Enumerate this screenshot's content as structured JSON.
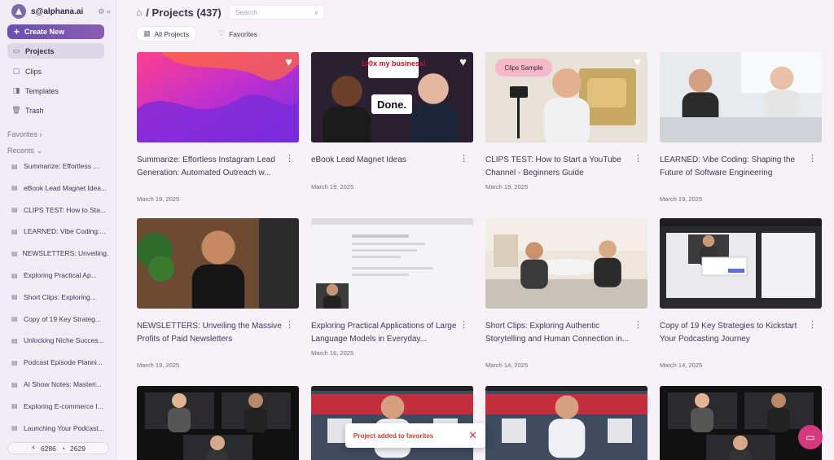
{
  "account": {
    "email": "s@alphana.ai"
  },
  "sidebar": {
    "create_label": "Create New",
    "nav": [
      {
        "label": "Projects",
        "icon": "folder-icon",
        "active": true
      },
      {
        "label": "Clips",
        "icon": "clip-icon"
      },
      {
        "label": "Templates",
        "icon": "template-icon"
      },
      {
        "label": "Trash",
        "icon": "trash-icon"
      }
    ],
    "favorites_label": "Favorites",
    "recents_label": "Recents",
    "recents": [
      "Summarize: Effortless ...",
      "eBook Lead Magnet Idea...",
      "CLIPS TEST: How to Sta...",
      "LEARNED: Vibe Coding:...",
      "NEWSLETTERS: Unveiling...",
      "Exploring Practical Ap...",
      "Short Clips: Exploring...",
      "Copy of 19 Key Strateg...",
      "Unlocking Niche Succes...",
      "Podcast Episode Planni...",
      "AI Show Notes: Masteri...",
      "Exploring E-commerce I...",
      "Launching Your Podcast..."
    ],
    "credits_a": "6286",
    "credits_b": "2629"
  },
  "header": {
    "title": "/ Projects (437)",
    "search_placeholder": "Search"
  },
  "tabs": [
    {
      "label": "All Projects",
      "icon": "grid-icon"
    },
    {
      "label": "Favorites",
      "icon": "heart-icon"
    }
  ],
  "cards": [
    {
      "title": "Summarize: Effortless Instagram Lead Generation: Automated Outreach w...",
      "date": "March 19, 2025",
      "favorite": true,
      "thumb": "gradient"
    },
    {
      "title": "eBook Lead Magnet Ideas",
      "date": "March 19, 2025",
      "favorite": true,
      "thumb": "duo",
      "overlay_top": "100x my business!",
      "overlay_bottom": "Done."
    },
    {
      "title": "CLIPS TEST: How to Start a YouTube Channel - Beginners Guide",
      "date": "March 19, 2025",
      "favorite": true,
      "thumb": "youtuber",
      "overlay_top": "Clips Sample"
    },
    {
      "title": "LEARNED: Vibe Coding: Shaping the Future of Software Engineering",
      "date": "March 19, 2025",
      "favorite": false,
      "thumb": "podcast"
    },
    {
      "title": "NEWSLETTERS: Unveiling the Massive Profits of Paid Newsletters",
      "date": "March 19, 2025",
      "favorite": false,
      "thumb": "talker"
    },
    {
      "title": "Exploring Practical Applications of Large Language Models in Everyday...",
      "date": "March 16, 2025",
      "favorite": false,
      "thumb": "screen"
    },
    {
      "title": "Short Clips: Exploring Authentic Storytelling and Human Connection in...",
      "date": "March 14, 2025",
      "favorite": false,
      "thumb": "office"
    },
    {
      "title": "Copy of 19 Key Strategies to Kickstart Your Podcasting Journey",
      "date": "March 14, 2025",
      "favorite": false,
      "thumb": "call"
    },
    {
      "title": "",
      "date": "",
      "favorite": false,
      "thumb": "grid"
    },
    {
      "title": "",
      "date": "",
      "favorite": false,
      "thumb": "studio"
    },
    {
      "title": "",
      "date": "",
      "favorite": false,
      "thumb": "studio"
    },
    {
      "title": "",
      "date": "",
      "favorite": false,
      "thumb": "grid"
    }
  ],
  "toast": {
    "message": "Project added to favorites"
  },
  "colors": {
    "accent": "#6a4fb0",
    "toast_text": "#d33a3a",
    "chat": "#d6387d"
  }
}
